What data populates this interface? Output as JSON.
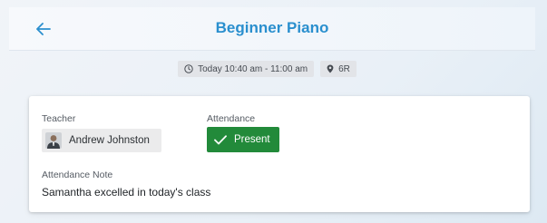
{
  "header": {
    "title": "Beginner Piano",
    "back_icon": "arrow-left-icon"
  },
  "meta": {
    "time_icon": "clock-icon",
    "time": "Today 10:40 am - 11:00 am",
    "location_icon": "location-pin-icon",
    "room": "6R"
  },
  "card": {
    "teacher_label": "Teacher",
    "teacher_name": "Andrew Johnston",
    "attendance_label": "Attendance",
    "attendance_status": "Present",
    "attendance_icon": "check-icon",
    "attendance_color": "#228a3a",
    "note_label": "Attendance Note",
    "note_text": "Samantha excelled in today's class"
  },
  "colors": {
    "accent": "#2a8fce"
  }
}
